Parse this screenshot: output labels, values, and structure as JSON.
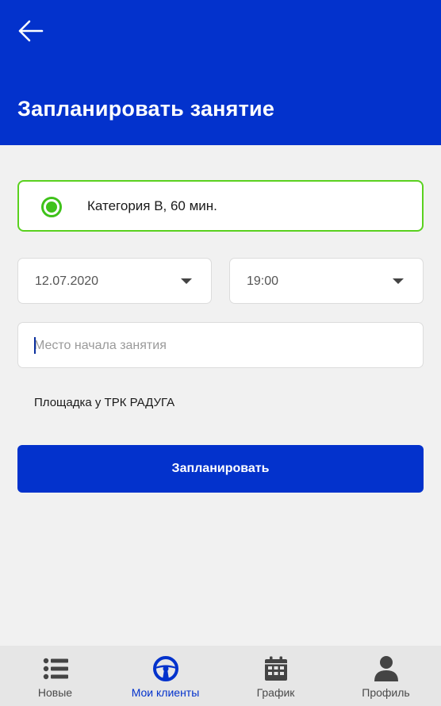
{
  "header": {
    "title": "Запланировать занятие",
    "back_icon": "arrow-left-icon"
  },
  "category": {
    "label": "Категория B, 60 мин.",
    "selected": true,
    "accent_color": "#3fc21a"
  },
  "date_select": {
    "value": "12.07.2020"
  },
  "time_select": {
    "value": "19:00"
  },
  "place_input": {
    "value": "",
    "placeholder": "Место начала занятия"
  },
  "place_text": "Площадка у ТРК РАДУГА",
  "submit_button": {
    "label": "Запланировать"
  },
  "colors": {
    "brand": "#0332cc",
    "success": "#3fc21a",
    "background": "#f1f1f1"
  },
  "bottom_nav": {
    "items": [
      {
        "label": "Новые",
        "icon": "list-icon",
        "active": false
      },
      {
        "label": "Мои клиенты",
        "icon": "steering-wheel-icon",
        "active": true
      },
      {
        "label": "График",
        "icon": "calendar-icon",
        "active": false
      },
      {
        "label": "Профиль",
        "icon": "person-icon",
        "active": false
      }
    ]
  }
}
